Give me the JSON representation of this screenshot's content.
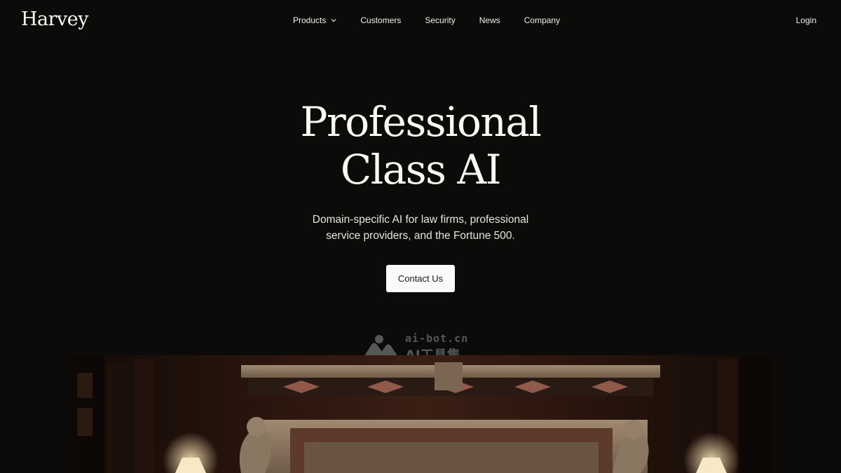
{
  "brand": {
    "name": "Harvey"
  },
  "nav": {
    "items": [
      {
        "label": "Products",
        "has_dropdown": true
      },
      {
        "label": "Customers"
      },
      {
        "label": "Security"
      },
      {
        "label": "News"
      },
      {
        "label": "Company"
      }
    ],
    "login_label": "Login"
  },
  "hero": {
    "headline_line1": "Professional",
    "headline_line2": "Class AI",
    "subtitle": "Domain-specific AI for law firms, professional service providers, and the Fortune 500.",
    "cta_label": "Contact Us"
  },
  "watermark": {
    "line1": "ai-bot.cn",
    "line2": "AI工具集"
  },
  "colors": {
    "background": "#0c0b0a",
    "text": "#f4f1ec",
    "button_bg": "#fbfaf8",
    "button_text": "#1a1917"
  },
  "icons": {
    "products_dropdown": "chevron-down-icon",
    "watermark_logo": "ai-bot-logo-icon"
  }
}
